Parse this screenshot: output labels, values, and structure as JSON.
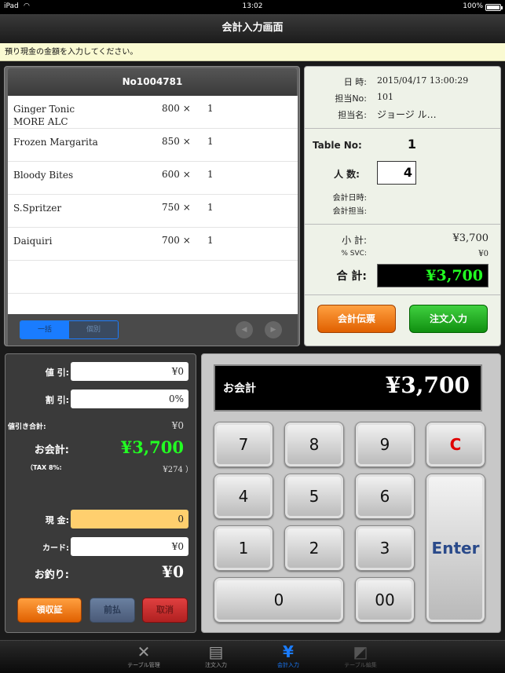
{
  "status": {
    "device": "iPad",
    "time": "13:02",
    "battery": "100%"
  },
  "nav": {
    "title": "会計入力画面"
  },
  "hint": "預り現金の金額を入力してください。",
  "order": {
    "number": "No1004781",
    "items": [
      {
        "name": "Ginger Tonic",
        "sub": "MORE ALC",
        "price": "800 ×",
        "qty": "1"
      },
      {
        "name": "Frozen Margarita",
        "sub": "",
        "price": "850 ×",
        "qty": "1"
      },
      {
        "name": "Bloody Bites",
        "sub": "",
        "price": "600 ×",
        "qty": "1"
      },
      {
        "name": "S.Spritzer",
        "sub": "",
        "price": "750 ×",
        "qty": "1"
      },
      {
        "name": "Daiquiri",
        "sub": "",
        "price": "700 ×",
        "qty": "1"
      }
    ],
    "seg_all": "一括",
    "seg_each": "個別",
    "prev": "◀",
    "next": "▶"
  },
  "info": {
    "date_label": "日 時:",
    "date": "2015/04/17 13:00:29",
    "staff_no_label": "担当No:",
    "staff_no": "101",
    "staff_name_label": "担当名:",
    "staff_name": "ジョージ ル…",
    "table_label": "Table No:",
    "table": "1",
    "people_label": "人 数:",
    "people": "4",
    "pay_date_label": "会計日時:",
    "pay_staff_label": "会計担当:",
    "subtotal_label": "小 計:",
    "subtotal": "¥3,700",
    "svc_label": "% SVC:",
    "svc": "¥0",
    "total_label": "合 計:",
    "total": "¥3,700",
    "slip_button": "会計伝票",
    "order_button": "注文入力"
  },
  "payment": {
    "discount_label": "値 引:",
    "discount": "¥0",
    "rate_label": "割 引:",
    "rate": "0%",
    "disc_total_label": "値引き合計:",
    "disc_total": "¥0",
    "amount_label": "お会計:",
    "amount": "¥3,700",
    "tax_label": "（TAX 8%:",
    "tax": "¥274 ）",
    "cash_label": "現 金:",
    "cash": "0",
    "card_label": "カード:",
    "card": "¥0",
    "change_label": "お釣り:",
    "change": "¥0",
    "receipt_button": "領収証",
    "prepay_button": "前払",
    "cancel_button": "取消"
  },
  "keypad": {
    "display_label": "お会計",
    "display_value": "¥3,700",
    "k7": "7",
    "k8": "8",
    "k9": "9",
    "kc": "C",
    "k4": "4",
    "k5": "5",
    "k6": "6",
    "k1": "1",
    "k2": "2",
    "k3": "3",
    "enter": "Enter",
    "k0": "0",
    "k00": "00"
  },
  "tabs": [
    {
      "label": "テーブル管理",
      "icon": "fork-knife-icon"
    },
    {
      "label": "注文入力",
      "icon": "clipboard-icon"
    },
    {
      "label": "会計入力",
      "icon": "yen-icon"
    },
    {
      "label": "テーブル編集",
      "icon": "table-edit-icon"
    }
  ],
  "colors": {
    "accent_blue": "#1a7cff",
    "total_green": "#22ff22",
    "orange": "#f07010",
    "green": "#20b020"
  }
}
